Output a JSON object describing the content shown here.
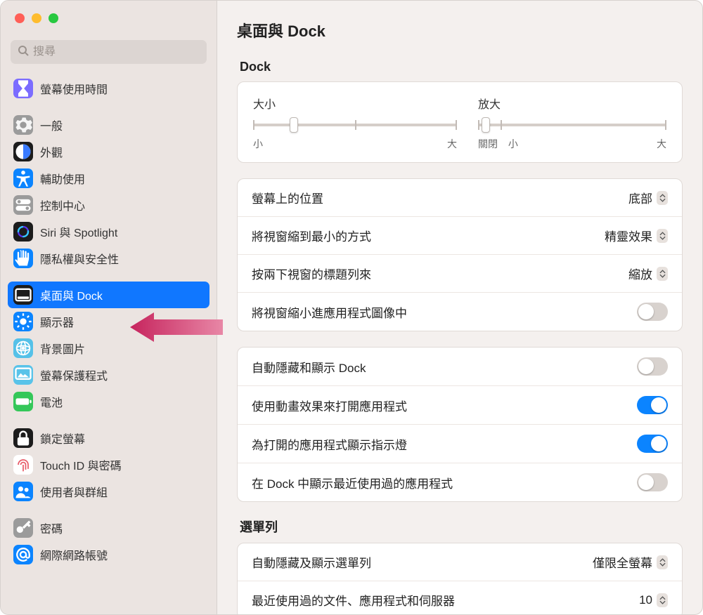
{
  "search": {
    "placeholder": "搜尋"
  },
  "sidebar": {
    "groups": [
      {
        "items": [
          {
            "id": "screen-time",
            "label": "螢幕使用時間",
            "icon": "hourglass",
            "bg": "#7b6cff"
          }
        ]
      },
      {
        "items": [
          {
            "id": "general",
            "label": "一般",
            "icon": "gear",
            "bg": "#9b9b9b"
          },
          {
            "id": "appearance",
            "label": "外觀",
            "icon": "appearance",
            "bg": "#1c1c1c"
          },
          {
            "id": "accessibility",
            "label": "輔助使用",
            "icon": "accessibility",
            "bg": "#0b84ff"
          },
          {
            "id": "control-center",
            "label": "控制中心",
            "icon": "toggles",
            "bg": "#9b9b9b"
          },
          {
            "id": "siri-spotlight",
            "label": "Siri 與 Spotlight",
            "icon": "siri",
            "bg": "#1c1c1c"
          },
          {
            "id": "privacy-security",
            "label": "隱私權與安全性",
            "icon": "hand",
            "bg": "#0b84ff"
          }
        ]
      },
      {
        "items": [
          {
            "id": "desktop-dock",
            "label": "桌面與 Dock",
            "icon": "dock",
            "bg": "#1c1c1c",
            "selected": true
          },
          {
            "id": "displays",
            "label": "顯示器",
            "icon": "brightness",
            "bg": "#0b84ff"
          },
          {
            "id": "wallpaper",
            "label": "背景圖片",
            "icon": "wallpaper",
            "bg": "#55c1e8"
          },
          {
            "id": "screensaver",
            "label": "螢幕保護程式",
            "icon": "screensaver",
            "bg": "#59c3e9"
          },
          {
            "id": "battery",
            "label": "電池",
            "icon": "battery",
            "bg": "#34c759"
          }
        ]
      },
      {
        "items": [
          {
            "id": "lock-screen",
            "label": "鎖定螢幕",
            "icon": "lock",
            "bg": "#1c1c1c"
          },
          {
            "id": "touch-id",
            "label": "Touch ID 與密碼",
            "icon": "fingerprint",
            "bg": "#ffffff"
          },
          {
            "id": "users-groups",
            "label": "使用者與群組",
            "icon": "users",
            "bg": "#0b84ff"
          }
        ]
      },
      {
        "items": [
          {
            "id": "passwords",
            "label": "密碼",
            "icon": "key",
            "bg": "#9b9b9b"
          },
          {
            "id": "internet-accounts",
            "label": "網際網路帳號",
            "icon": "at",
            "bg": "#0b84ff"
          }
        ]
      }
    ]
  },
  "page": {
    "title": "桌面與 Dock"
  },
  "dock": {
    "section": "Dock",
    "size": {
      "label": "大小",
      "min": "小",
      "max": "大",
      "value_pct": 20
    },
    "magnification": {
      "label": "放大",
      "off_label": "關閉",
      "min": "小",
      "max": "大",
      "value_pct": 4
    },
    "position": {
      "label": "螢幕上的位置",
      "value": "底部"
    },
    "minimize_effect": {
      "label": "將視窗縮到最小的方式",
      "value": "精靈效果"
    },
    "double_click_titlebar": {
      "label": "按兩下視窗的標題列來",
      "value": "縮放"
    },
    "minimize_into_icon": {
      "label": "將視窗縮小進應用程式圖像中",
      "value": false
    },
    "autohide": {
      "label": "自動隱藏和顯示 Dock",
      "value": false
    },
    "animate_open": {
      "label": "使用動畫效果來打開應用程式",
      "value": true
    },
    "show_indicators": {
      "label": "為打開的應用程式顯示指示燈",
      "value": true
    },
    "show_recents": {
      "label": "在 Dock 中顯示最近使用過的應用程式",
      "value": false
    }
  },
  "menubar": {
    "section": "選單列",
    "autohide": {
      "label": "自動隱藏及顯示選單列",
      "value": "僅限全螢幕"
    },
    "recent_items": {
      "label": "最近使用過的文件、應用程式和伺服器",
      "value": "10"
    }
  },
  "colors": {
    "accent": "#0b84ff"
  }
}
